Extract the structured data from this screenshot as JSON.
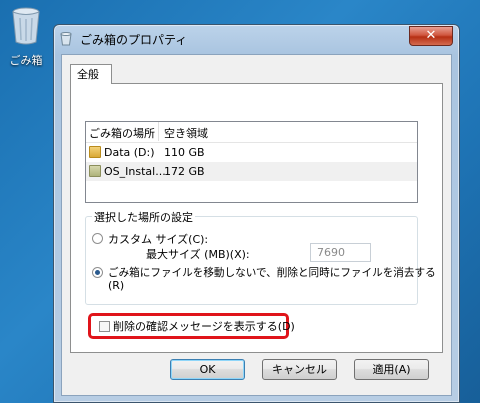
{
  "desktop": {
    "icon_label": "ごみ箱",
    "icon": "recycle-bin-icon"
  },
  "window": {
    "title": "ごみ箱のプロパティ",
    "close_label": "✕",
    "tab_label": "全般",
    "list": {
      "headers": [
        "ごみ箱の場所",
        "空き領域"
      ],
      "rows": [
        {
          "name": "Data (D:)",
          "free": "110 GB",
          "icon": "folder-icon"
        },
        {
          "name": "OS_Instal...",
          "free": "172 GB",
          "icon": "drive-folder-icon"
        }
      ]
    },
    "settings": {
      "title": "選択した場所の設定",
      "custom_size_label": "カスタム サイズ(C):",
      "max_size_label": "最大サイズ (MB)(X):",
      "max_size_value": "7690",
      "delete_now_label_1": "ごみ箱にファイルを移動しないで、削除と同時にファイルを消去する",
      "delete_now_label_2": "(R)",
      "custom_selected": false,
      "delete_now_selected": true
    },
    "confirm_label": "削除の確認メッセージを表示する(D)",
    "confirm_checked": false,
    "buttons": {
      "ok": "OK",
      "cancel": "キャンセル",
      "apply": "適用(A)"
    }
  }
}
